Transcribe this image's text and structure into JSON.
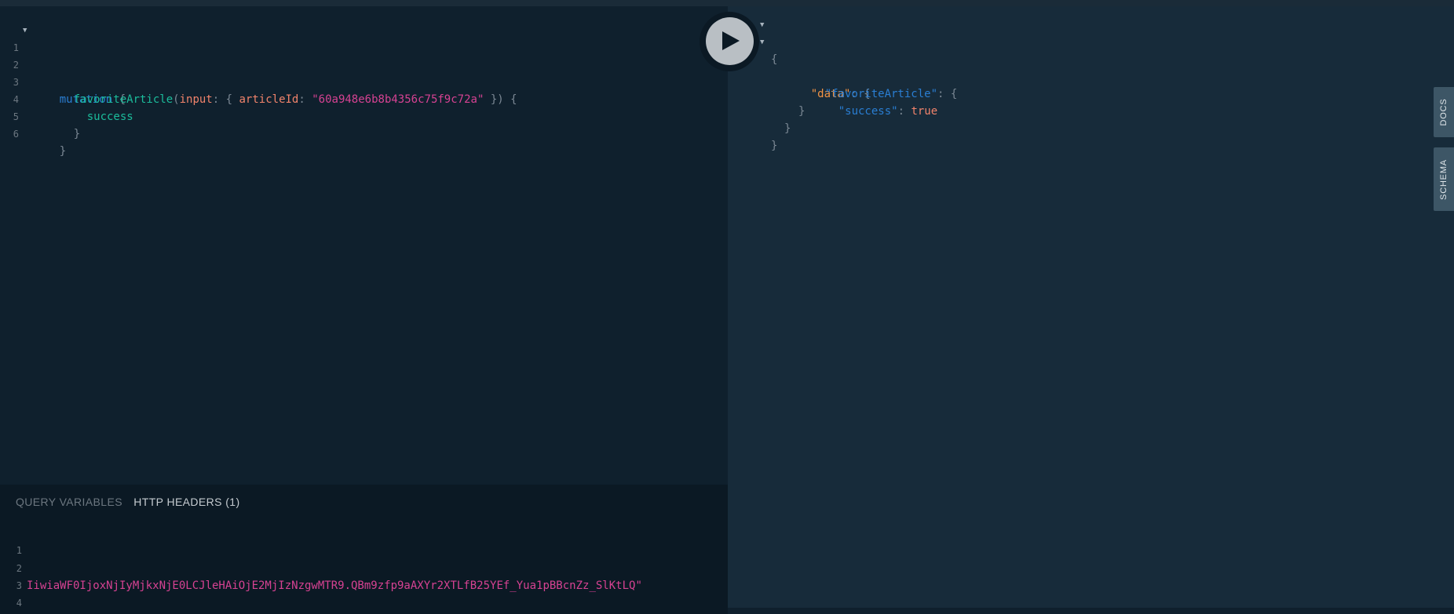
{
  "query_editor": {
    "line_numbers": [
      "1",
      "2",
      "3",
      "4",
      "5",
      "6"
    ],
    "keyword_mutation": "mutation",
    "open_brace": "{",
    "field_favorite": "favoriteArticle",
    "paren_open": "(",
    "arg_input": "input",
    "colon": ":",
    "inner_open": "{",
    "arg_article_id": "articleId",
    "article_id_value": "\"60a948e6b8b4356c75f9c72a\"",
    "inner_close": "})",
    "field_success": "success",
    "close_brace": "}"
  },
  "run_button": {
    "icon": "play-icon"
  },
  "result_viewer": {
    "open_brace": "{",
    "key_data": "\"data\"",
    "key_favorite": "\"favoriteArticle\"",
    "key_success": "\"success\"",
    "value_success": "true",
    "colon": ":",
    "close_brace": "}"
  },
  "variables_panel": {
    "tab_query_variables": "QUERY VARIABLES",
    "tab_http_headers": "HTTP HEADERS (1)",
    "line_numbers": [
      "1",
      "2",
      "3",
      "4"
    ],
    "header_value_visible": "IiwiaWF0IjoxNjIyMjkxNjE0LCJleHAiOjE2MjIzNzgwMTR9.QBm9zfp9aAXYr2XTLfB25YEf_Yua1pBBcnZz_SlKtLQ\""
  },
  "side_tabs": {
    "docs": "DOCS",
    "schema": "SCHEMA"
  },
  "colors": {
    "background": "#0f202d",
    "result_background": "#172b3a",
    "keyword": "#2a7ed3",
    "field": "#1bbc9b",
    "argument": "#f1836b",
    "string": "#d64292"
  }
}
